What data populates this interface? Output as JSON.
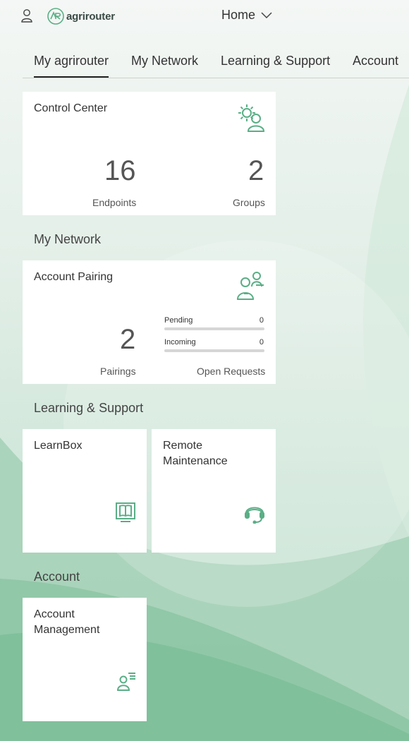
{
  "header": {
    "logo_text": "agrirouter",
    "home_label": "Home"
  },
  "tabs": [
    {
      "label": "My agrirouter",
      "active": true
    },
    {
      "label": "My Network",
      "active": false
    },
    {
      "label": "Learning & Support",
      "active": false
    },
    {
      "label": "Account",
      "active": false
    }
  ],
  "control_center": {
    "title": "Control Center",
    "endpoints_value": "16",
    "endpoints_label": "Endpoints",
    "groups_value": "2",
    "groups_label": "Groups",
    "icon": "gear-user-icon"
  },
  "sections": {
    "my_network": "My Network",
    "learning_support": "Learning & Support",
    "account": "Account"
  },
  "account_pairing": {
    "title": "Account Pairing",
    "pairings_value": "2",
    "pairings_label": "Pairings",
    "pending_label": "Pending",
    "pending_value": "0",
    "incoming_label": "Incoming",
    "incoming_value": "0",
    "open_requests_label": "Open Requests",
    "icon": "users-pairing-icon"
  },
  "learnbox": {
    "title": "LearnBox",
    "icon": "book-monitor-icon"
  },
  "remote_maintenance": {
    "title_line1": "Remote",
    "title_line2": "Maintenance",
    "icon": "headset-icon"
  },
  "account_management": {
    "title_line1": "Account",
    "title_line2": "Management",
    "icon": "user-list-icon"
  },
  "colors": {
    "accent": "#5aae86",
    "bg_green": "#7dbf9a"
  }
}
